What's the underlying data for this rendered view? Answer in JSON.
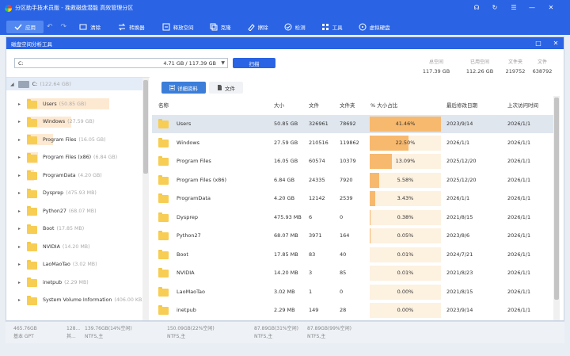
{
  "app": {
    "title": "分区助手技术员版 - 挽救磁盘潜能 高效管理分区"
  },
  "toolbar": {
    "apply": "应用",
    "items": [
      "清除",
      "转换器",
      "释放空间",
      "克隆",
      "擦除",
      "检测",
      "工具",
      "虚拟硬盘"
    ]
  },
  "dialog": {
    "title": "磁盘空间分析工具"
  },
  "drive": {
    "letter": "C:",
    "capacity": "4.71 GB / 117.39 GB"
  },
  "scan_label": "扫描",
  "stats": [
    {
      "label": "总空间",
      "value": "117.39 GB"
    },
    {
      "label": "已用空间",
      "value": "112.26 GB"
    },
    {
      "label": "文件夹",
      "value": "219752"
    },
    {
      "label": "文件",
      "value": "638792"
    }
  ],
  "tree": {
    "root": {
      "name": "C:",
      "size": "(122.64 GB)"
    },
    "items": [
      {
        "name": "Users",
        "size": "(50.85 GB)",
        "pct": 41.46
      },
      {
        "name": "Windows",
        "size": "(27.59 GB)",
        "pct": 22.5
      },
      {
        "name": "Program Files",
        "size": "(16.05 GB)",
        "pct": 13.09
      },
      {
        "name": "Program Files (x86)",
        "size": "(6.84 GB)",
        "pct": 5.58
      },
      {
        "name": "ProgramData",
        "size": "(4.20 GB)",
        "pct": 3.43
      },
      {
        "name": "Dysprep",
        "size": "(475.93 MB)",
        "pct": 0.38
      },
      {
        "name": "Python27",
        "size": "(68.07 MB)",
        "pct": 0.05
      },
      {
        "name": "Boot",
        "size": "(17.85 MB)",
        "pct": 0.01
      },
      {
        "name": "NVIDIA",
        "size": "(14.20 MB)",
        "pct": 0.01
      },
      {
        "name": "LaoMaoTao",
        "size": "(3.02 MB)",
        "pct": 0.0
      },
      {
        "name": "inetpub",
        "size": "(2.29 MB)",
        "pct": 0.0
      },
      {
        "name": "System Volume Information",
        "size": "(406.00 KB)",
        "pct": 0.0
      }
    ]
  },
  "tabs": {
    "details": "详细资料",
    "files": "文件"
  },
  "table": {
    "columns": [
      "名称",
      "大小",
      "文件",
      "文件夹",
      "% 大小占比",
      "最后修改日期",
      "上次访问时间"
    ],
    "rows": [
      {
        "name": "Users",
        "size": "50.85 GB",
        "files": "326961",
        "folders": "78692",
        "pct": 41.46,
        "pct_text": "41.46%",
        "modified": "2023/9/14",
        "accessed": "2026/1/1"
      },
      {
        "name": "Windows",
        "size": "27.59 GB",
        "files": "210516",
        "folders": "119862",
        "pct": 22.5,
        "pct_text": "22.50%",
        "modified": "2026/1/1",
        "accessed": "2026/1/1"
      },
      {
        "name": "Program Files",
        "size": "16.05 GB",
        "files": "60574",
        "folders": "10379",
        "pct": 13.09,
        "pct_text": "13.09%",
        "modified": "2025/12/20",
        "accessed": "2026/1/1"
      },
      {
        "name": "Program Files (x86)",
        "size": "6.84 GB",
        "files": "24335",
        "folders": "7920",
        "pct": 5.58,
        "pct_text": "5.58%",
        "modified": "2025/12/20",
        "accessed": "2026/1/1"
      },
      {
        "name": "ProgramData",
        "size": "4.20 GB",
        "files": "12142",
        "folders": "2539",
        "pct": 3.43,
        "pct_text": "3.43%",
        "modified": "2026/1/1",
        "accessed": "2026/1/1"
      },
      {
        "name": "Dysprep",
        "size": "475.93 MB",
        "files": "6",
        "folders": "0",
        "pct": 0.38,
        "pct_text": "0.38%",
        "modified": "2021/8/15",
        "accessed": "2026/1/1"
      },
      {
        "name": "Python27",
        "size": "68.07 MB",
        "files": "3971",
        "folders": "164",
        "pct": 0.05,
        "pct_text": "0.05%",
        "modified": "2023/8/6",
        "accessed": "2026/1/1"
      },
      {
        "name": "Boot",
        "size": "17.85 MB",
        "files": "83",
        "folders": "40",
        "pct": 0.01,
        "pct_text": "0.01%",
        "modified": "2024/7/21",
        "accessed": "2026/1/1"
      },
      {
        "name": "NVIDIA",
        "size": "14.20 MB",
        "files": "3",
        "folders": "85",
        "pct": 0.01,
        "pct_text": "0.01%",
        "modified": "2021/8/23",
        "accessed": "2026/1/1"
      },
      {
        "name": "LaoMaoTao",
        "size": "3.02 MB",
        "files": "1",
        "folders": "0",
        "pct": 0.0,
        "pct_text": "0.00%",
        "modified": "2021/8/15",
        "accessed": "2026/1/1"
      },
      {
        "name": "inetpub",
        "size": "2.29 MB",
        "files": "149",
        "folders": "28",
        "pct": 0.0,
        "pct_text": "0.00%",
        "modified": "2023/9/14",
        "accessed": "2026/1/1"
      }
    ]
  },
  "disk_strip": {
    "disk_size": "465.76GB",
    "disk_type": "基本 GPT",
    "p1_size": "128...",
    "p1_fs": "其...",
    "partitions": [
      {
        "cap": "139.76GB(14%空闲)",
        "fs": "NTFS,主"
      },
      {
        "cap": "150.09GB(22%空闲)",
        "fs": "NTFS,主"
      },
      {
        "cap": "87.89GB(31%空闲)",
        "fs": "NTFS,主"
      },
      {
        "cap": "87.89GB(99%空闲)",
        "fs": "NTFS,主"
      }
    ]
  },
  "colors": {
    "header": "#2a63e3",
    "bar_fill": "#f7b96e",
    "bar_track": "#fdf1e0",
    "folder": "#f7cd54"
  }
}
